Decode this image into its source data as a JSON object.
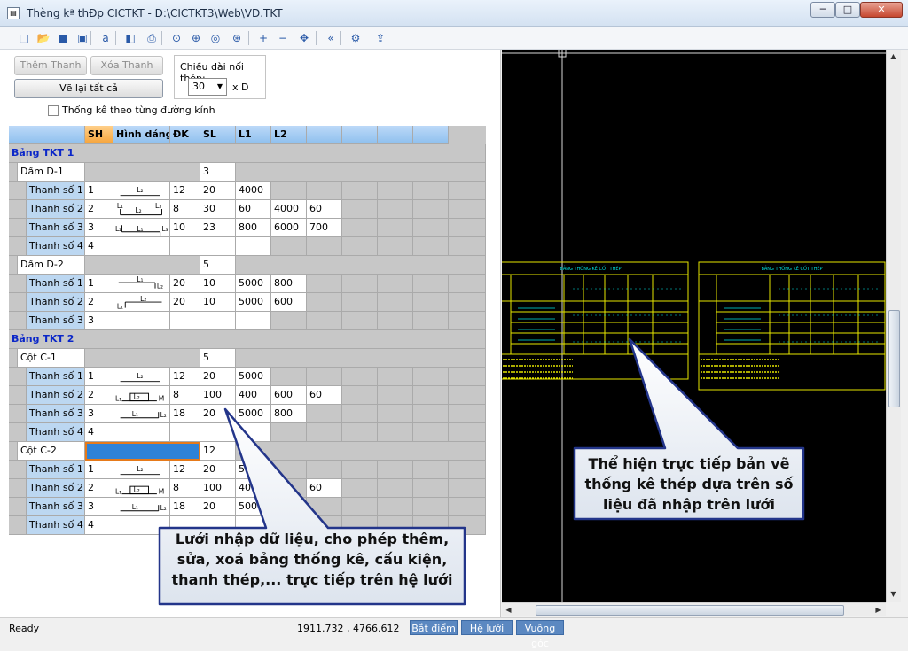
{
  "window": {
    "title": "Thèng kª thÐp CICTKT - D:\\CICTKT3\\Web\\VD.TKT",
    "minimize_glyph": "─",
    "maximize_glyph": "□",
    "close_glyph": "✕"
  },
  "toolbar": {
    "icons": [
      "new-file-icon",
      "open-folder-icon",
      "save-icon",
      "save-as-icon",
      "font-icon",
      "preview-icon",
      "print-icon",
      "zoom-window-icon",
      "zoom-realtime-icon",
      "zoom-previous-icon",
      "zoom-extents-icon",
      "zoom-in-icon",
      "zoom-out-icon",
      "pan-icon",
      "double-chevron-left-icon",
      "settings-icon",
      "export-icon"
    ]
  },
  "left_panel": {
    "add_bar_label": "Thêm Thanh",
    "delete_bar_label": "Xóa Thanh",
    "redraw_all_label": "Vẽ lại tất cả",
    "splice_length_label": "Chiều dài nối thép:",
    "splice_length_value": "30",
    "splice_unit": "x D",
    "per_diameter_label": "Thống kê theo từng đường kính",
    "per_diameter_checked": false
  },
  "grid": {
    "columns": [
      "SH",
      "Hình dáng",
      "ĐK",
      "SL",
      "L1",
      "L2",
      "",
      "",
      "",
      ""
    ],
    "rows": [
      {
        "kind": "table",
        "label": "Bảng TKT 1"
      },
      {
        "kind": "member",
        "label": "Dầm D-1",
        "sl": "3"
      },
      {
        "kind": "bar",
        "label": "Thanh số 1",
        "sh": "1",
        "shape": "L2",
        "dk": "12",
        "sl": "20",
        "l1": "4000",
        "l2": "",
        "l3": ""
      },
      {
        "kind": "bar",
        "label": "Thanh số 2",
        "sh": "2",
        "shape": "L1L2L3",
        "dk": "8",
        "sl": "30",
        "l1": "60",
        "l2": "4000",
        "l3": "60"
      },
      {
        "kind": "bar",
        "label": "Thanh số 3",
        "sh": "3",
        "shape": "L2L1L3",
        "dk": "10",
        "sl": "23",
        "l1": "800",
        "l2": "6000",
        "l3": "700"
      },
      {
        "kind": "bar",
        "label": "Thanh số 4",
        "sh": "4",
        "shape": "",
        "dk": "",
        "sl": "",
        "l1": "",
        "l2": "",
        "l3": ""
      },
      {
        "kind": "member",
        "label": "Dầm D-2",
        "sl": "5"
      },
      {
        "kind": "bar",
        "label": "Thanh số 1",
        "sh": "1",
        "shape": "L1L2",
        "dk": "20",
        "sl": "10",
        "l1": "5000",
        "l2": "800",
        "l3": ""
      },
      {
        "kind": "bar",
        "label": "Thanh số 2",
        "sh": "2",
        "shape": "L2L1",
        "dk": "20",
        "sl": "10",
        "l1": "5000",
        "l2": "600",
        "l3": ""
      },
      {
        "kind": "bar",
        "label": "Thanh số 3",
        "sh": "3",
        "shape": "",
        "dk": "",
        "sl": "",
        "l1": "",
        "l2": "",
        "l3": ""
      },
      {
        "kind": "table",
        "label": "Bảng TKT 2"
      },
      {
        "kind": "member",
        "label": "Cột C-1",
        "sl": "5"
      },
      {
        "kind": "bar",
        "label": "Thanh số 1",
        "sh": "1",
        "shape": "L2",
        "dk": "12",
        "sl": "20",
        "l1": "5000",
        "l2": "",
        "l3": ""
      },
      {
        "kind": "bar",
        "label": "Thanh số 2",
        "sh": "2",
        "shape": "L1L2M",
        "dk": "8",
        "sl": "100",
        "l1": "400",
        "l2": "600",
        "l3": "60"
      },
      {
        "kind": "bar",
        "label": "Thanh số 3",
        "sh": "3",
        "shape": "L1L2hook",
        "dk": "18",
        "sl": "20",
        "l1": "5000",
        "l2": "800",
        "l3": ""
      },
      {
        "kind": "bar",
        "label": "Thanh số 4",
        "sh": "4",
        "shape": "",
        "dk": "",
        "sl": "",
        "l1": "",
        "l2": "",
        "l3": ""
      },
      {
        "kind": "member",
        "label": "Cột C-2",
        "sl": "12",
        "selected": true
      },
      {
        "kind": "bar",
        "label": "Thanh số 1",
        "sh": "1",
        "shape": "L2",
        "dk": "12",
        "sl": "20",
        "l1": "500",
        "l2": "",
        "l3": ""
      },
      {
        "kind": "bar",
        "label": "Thanh số 2",
        "sh": "2",
        "shape": "L1L2M",
        "dk": "8",
        "sl": "100",
        "l1": "400",
        "l2": "",
        "l3": "60"
      },
      {
        "kind": "bar",
        "label": "Thanh số 3",
        "sh": "3",
        "shape": "L1L2hook",
        "dk": "18",
        "sl": "20",
        "l1": "5000",
        "l2": "",
        "l3": ""
      },
      {
        "kind": "bar",
        "label": "Thanh số 4",
        "sh": "4",
        "shape": "",
        "dk": "",
        "sl": "",
        "l1": "",
        "l2": "",
        "l3": ""
      }
    ]
  },
  "drawing": {
    "background": "#000000",
    "line_color": "#e6e600",
    "text_color": "#00e5e5",
    "table_title": "BẢNG THỐNG KÊ CỐT THÉP"
  },
  "callouts": {
    "grid_note": "Lưới nhập dữ liệu, cho phép thêm, sửa, xoá bảng thống kê, cấu kiện, thanh thép,... trực tiếp trên hệ lưới",
    "drawing_note": "Thể hiện trực tiếp bản vẽ thống kê thép dựa trên số liệu đã nhập trên lưới"
  },
  "status": {
    "ready": "Ready",
    "coords": "1911.732 , 4766.612",
    "snap_label": "Bắt điểm",
    "grid_label": "Hệ lưới",
    "ortho_label": "Vuông góc"
  },
  "colors": {
    "accent": "#5b88c1",
    "header": "#8fc0ee",
    "sh_header": "#f6a53c",
    "group_text": "#0b27c8",
    "selected": "#2e82d8"
  }
}
